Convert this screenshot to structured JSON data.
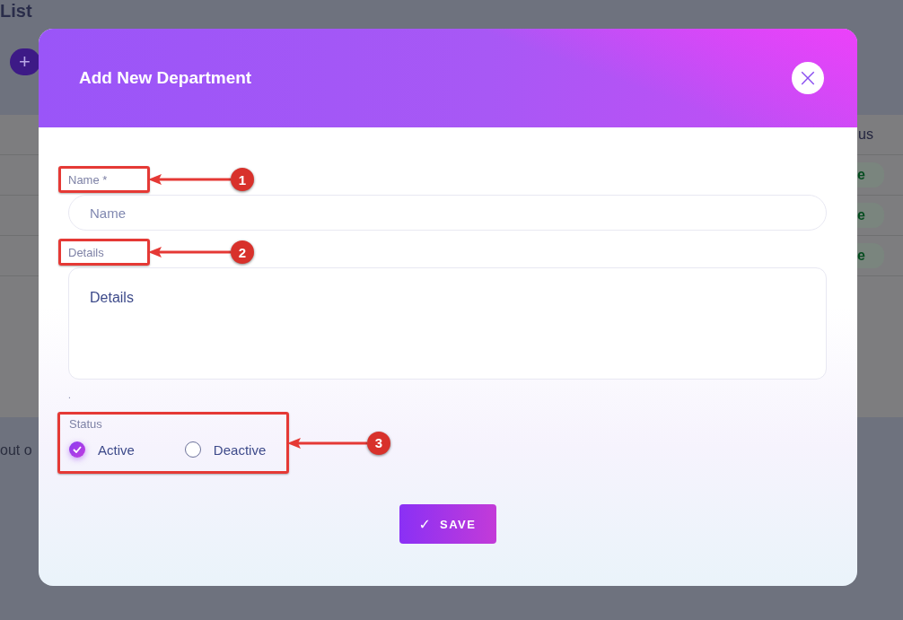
{
  "background": {
    "title": "List",
    "add_button": "+",
    "table": {
      "header": "us",
      "rows": [
        {
          "status": "e"
        },
        {
          "status": "e"
        },
        {
          "status": "e"
        }
      ]
    },
    "footer_text": "out o"
  },
  "modal": {
    "title": "Add New Department",
    "close_icon": "×",
    "fields": [
      {
        "kind": "input",
        "label": "Name *",
        "placeholder": "Name",
        "callout": "1"
      },
      {
        "kind": "textarea",
        "label": "Details",
        "placeholder": "Details",
        "callout": "2"
      }
    ],
    "note": ".",
    "status": {
      "label": "Status",
      "callout": "3",
      "options": [
        {
          "label": "Active",
          "selected": true
        },
        {
          "label": "Deactive",
          "selected": false
        }
      ]
    },
    "save_button": {
      "icon": "✓",
      "label": "SAVE"
    }
  }
}
